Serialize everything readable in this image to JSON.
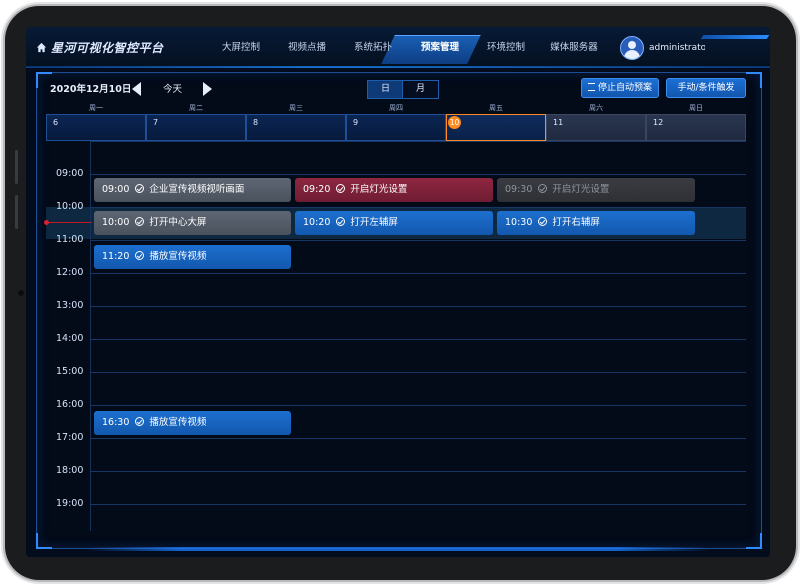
{
  "app": {
    "title": "星河可视化智控平台"
  },
  "nav": {
    "items": [
      {
        "label": "大屏控制"
      },
      {
        "label": "视频点播"
      },
      {
        "label": "系统拓扑"
      },
      {
        "label": "预案管理",
        "active": true
      },
      {
        "label": "环境控制"
      },
      {
        "label": "媒体服务器"
      }
    ]
  },
  "user": {
    "name": "administrator"
  },
  "toolbar": {
    "date": "2020年12月10日",
    "today_label": "今天",
    "view_day": "日",
    "view_month": "月",
    "stop_auto_label": "停止自动预案",
    "manual_trigger_label": "手动/条件触发"
  },
  "week": {
    "days": [
      "周一",
      "周二",
      "周三",
      "周四",
      "周五",
      "周六",
      "周日"
    ],
    "dates": [
      "6",
      "7",
      "8",
      "9",
      "10",
      "11",
      "12"
    ],
    "today_index": 4
  },
  "timeline": {
    "hours": [
      "09:00",
      "10:00",
      "11:00",
      "12:00",
      "13:00",
      "14:00",
      "15:00",
      "16:00",
      "17:00",
      "18:00",
      "19:00"
    ]
  },
  "events": [
    {
      "time": "09:00",
      "title": "企业宣传视频视听画面",
      "state": "done"
    },
    {
      "time": "09:20",
      "title": "开启灯光设置",
      "state": "failed"
    },
    {
      "time": "09:30",
      "title": "开启灯光设置",
      "state": "disabled"
    },
    {
      "time": "10:00",
      "title": "打开中心大屏",
      "state": "done"
    },
    {
      "time": "10:20",
      "title": "打开左辅屏",
      "state": "pending"
    },
    {
      "time": "10:30",
      "title": "打开右辅屏",
      "state": "pending"
    },
    {
      "time": "11:20",
      "title": "播放宣传视频",
      "state": "pending"
    },
    {
      "time": "16:30",
      "title": "播放宣传视频",
      "state": "pending"
    }
  ],
  "colors": {
    "accent": "#1c6fd4",
    "today": "#ff8a1f",
    "failed": "#8e2740",
    "done": "#5e6673",
    "now_line": "#c01a2a"
  }
}
